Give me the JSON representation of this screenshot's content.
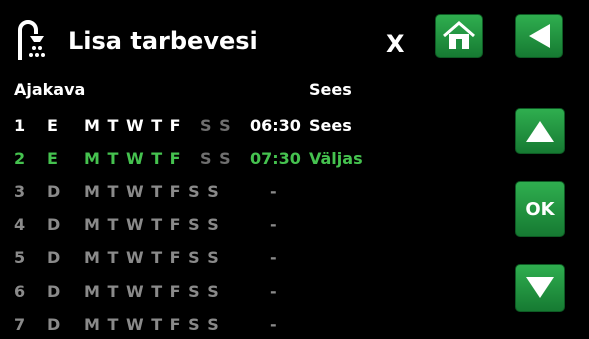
{
  "header": {
    "title": "Lisa tarbevesi",
    "close_label": "X"
  },
  "columns": {
    "schedule": "Ajakava",
    "status": "Sees"
  },
  "rows": [
    {
      "num": "1",
      "mode": "E",
      "days": "MTWTF",
      "off_days": "SS",
      "time": "06:30",
      "status": "Sees",
      "state": "active"
    },
    {
      "num": "2",
      "mode": "E",
      "days": "MTWTF",
      "off_days": "SS",
      "time": "07:30",
      "status": "Väljas",
      "state": "selected"
    },
    {
      "num": "3",
      "mode": "D",
      "days": "MTWTFSS",
      "off_days": "",
      "time": "-",
      "status": "",
      "state": "disabled"
    },
    {
      "num": "4",
      "mode": "D",
      "days": "MTWTFSS",
      "off_days": "",
      "time": "-",
      "status": "",
      "state": "disabled"
    },
    {
      "num": "5",
      "mode": "D",
      "days": "MTWTFSS",
      "off_days": "",
      "time": "-",
      "status": "",
      "state": "disabled"
    },
    {
      "num": "6",
      "mode": "D",
      "days": "MTWTFSS",
      "off_days": "",
      "time": "-",
      "status": "",
      "state": "disabled"
    },
    {
      "num": "7",
      "mode": "D",
      "days": "MTWTFSS",
      "off_days": "",
      "time": "-",
      "status": "",
      "state": "disabled"
    }
  ],
  "buttons": {
    "ok_label": "OK"
  },
  "colors": {
    "button_green": "#1f9a3e",
    "selected_text": "#45c24f",
    "disabled_text": "#8a8a8a"
  },
  "icons": {
    "title": "shower-icon",
    "home": "home-icon",
    "back": "back-arrow-icon",
    "up": "up-arrow-icon",
    "down": "down-arrow-icon"
  }
}
